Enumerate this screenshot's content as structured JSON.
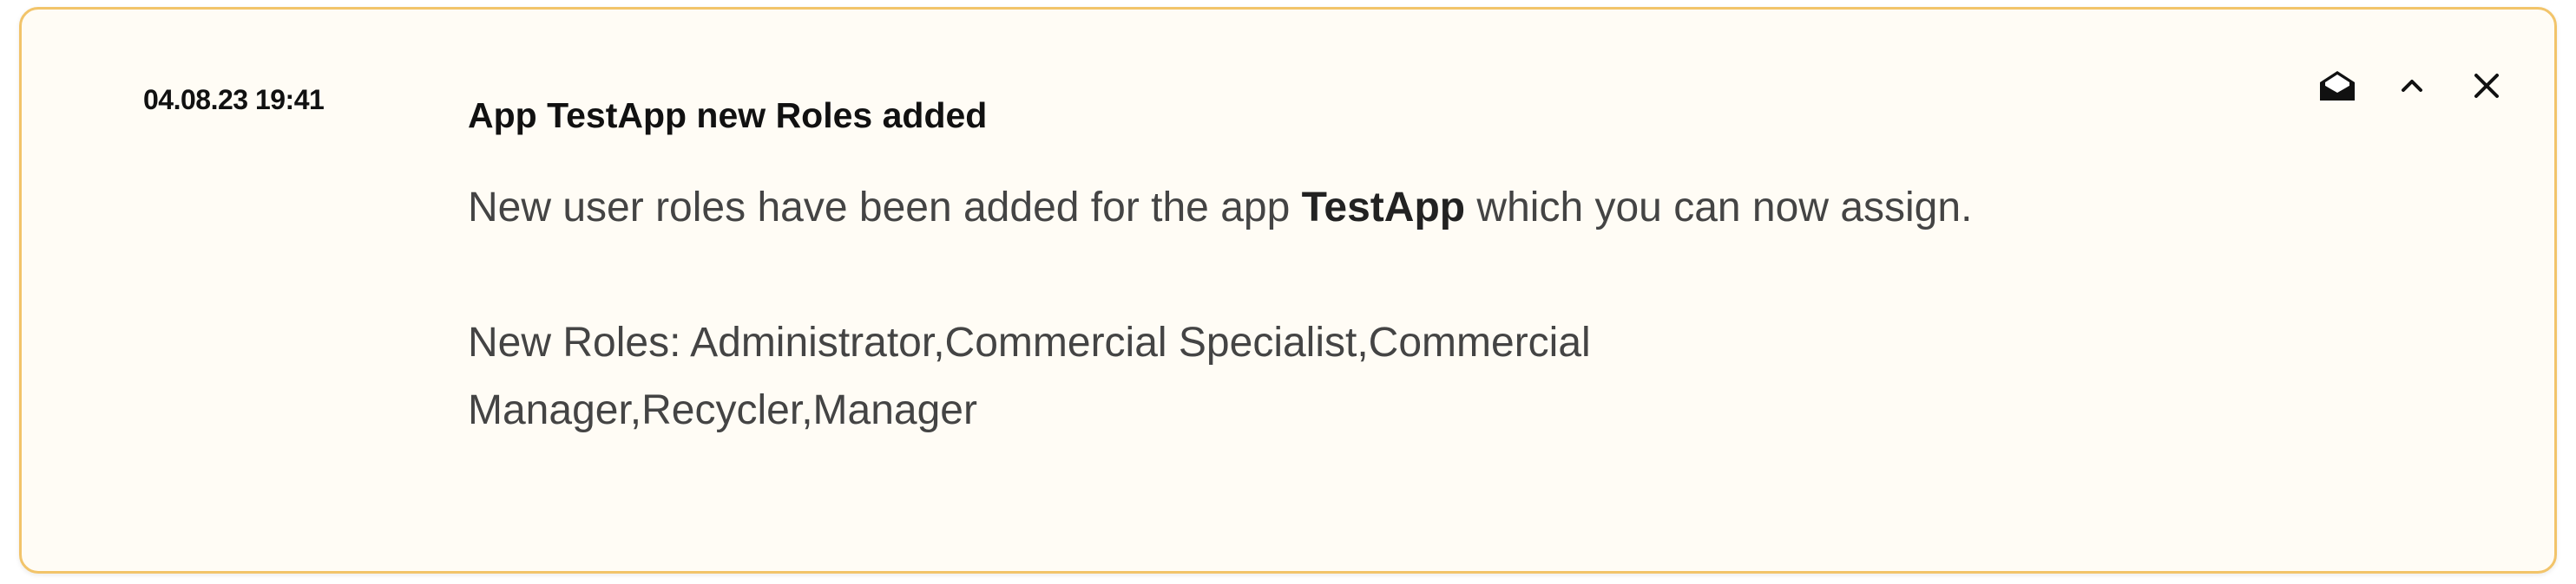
{
  "notification": {
    "timestamp": "04.08.23 19:41",
    "title": "App TestApp new Roles added",
    "body_prefix": "New user roles have been added for the app ",
    "app_name": "TestApp",
    "body_suffix": " which you can now assign.",
    "roles_text": "New Roles: Administrator,Commercial Specialist,Commercial Manager,Recycler,Manager"
  },
  "actions": {
    "icons": [
      "envelope-open-icon",
      "chevron-up-icon",
      "close-icon"
    ]
  },
  "colors": {
    "border": "#f2c46a",
    "background": "#fffcf5",
    "text_primary": "#111111",
    "text_body": "#444444"
  }
}
